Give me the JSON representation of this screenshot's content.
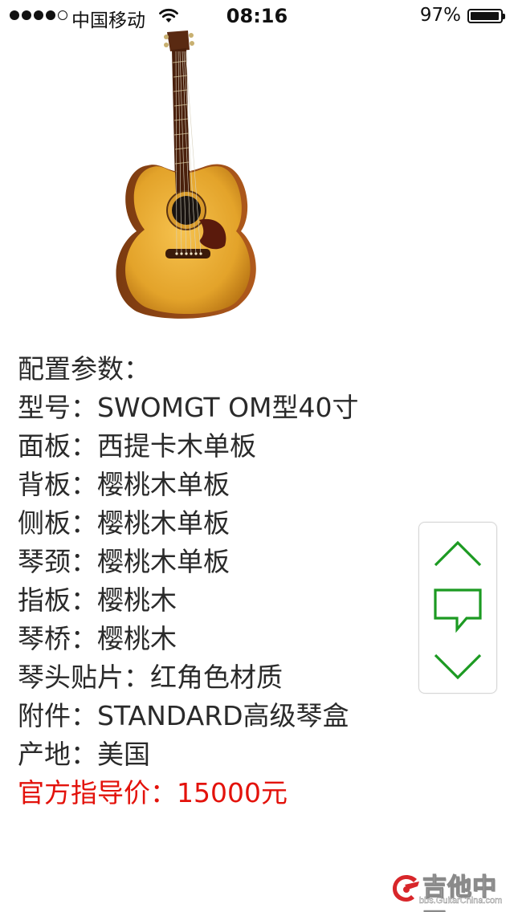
{
  "status_bar": {
    "carrier": "中国移动",
    "time": "08:16",
    "battery_percent": "97%",
    "battery_level": 0.97,
    "signal_bars_filled": 4,
    "signal_bars_total": 5
  },
  "product_image": {
    "icon": "acoustic-guitar-image"
  },
  "specs": {
    "heading": "配置参数：",
    "lines": [
      "型号：SWOMGT OM型40寸",
      "面板：西提卡木单板",
      "背板：樱桃木单板",
      "侧板：樱桃木单板",
      "琴颈：樱桃木单板",
      "指板：樱桃木",
      "琴桥：樱桃木",
      "琴头贴片：红角色材质",
      "附件：STANDARD高级琴盒",
      "产地：美国"
    ],
    "price": "官方指导价：15000元"
  },
  "float_controls": {
    "up_icon": "chevron-up-icon",
    "comment_icon": "comment-icon",
    "down_icon": "chevron-down-icon",
    "accent_color": "#1c9a22"
  },
  "watermark": {
    "title": "吉他中国",
    "url": "bbs.GuitarChina.com"
  },
  "colors": {
    "price": "#e3120b",
    "text": "#2a2a2a",
    "accent": "#1c9a22"
  }
}
